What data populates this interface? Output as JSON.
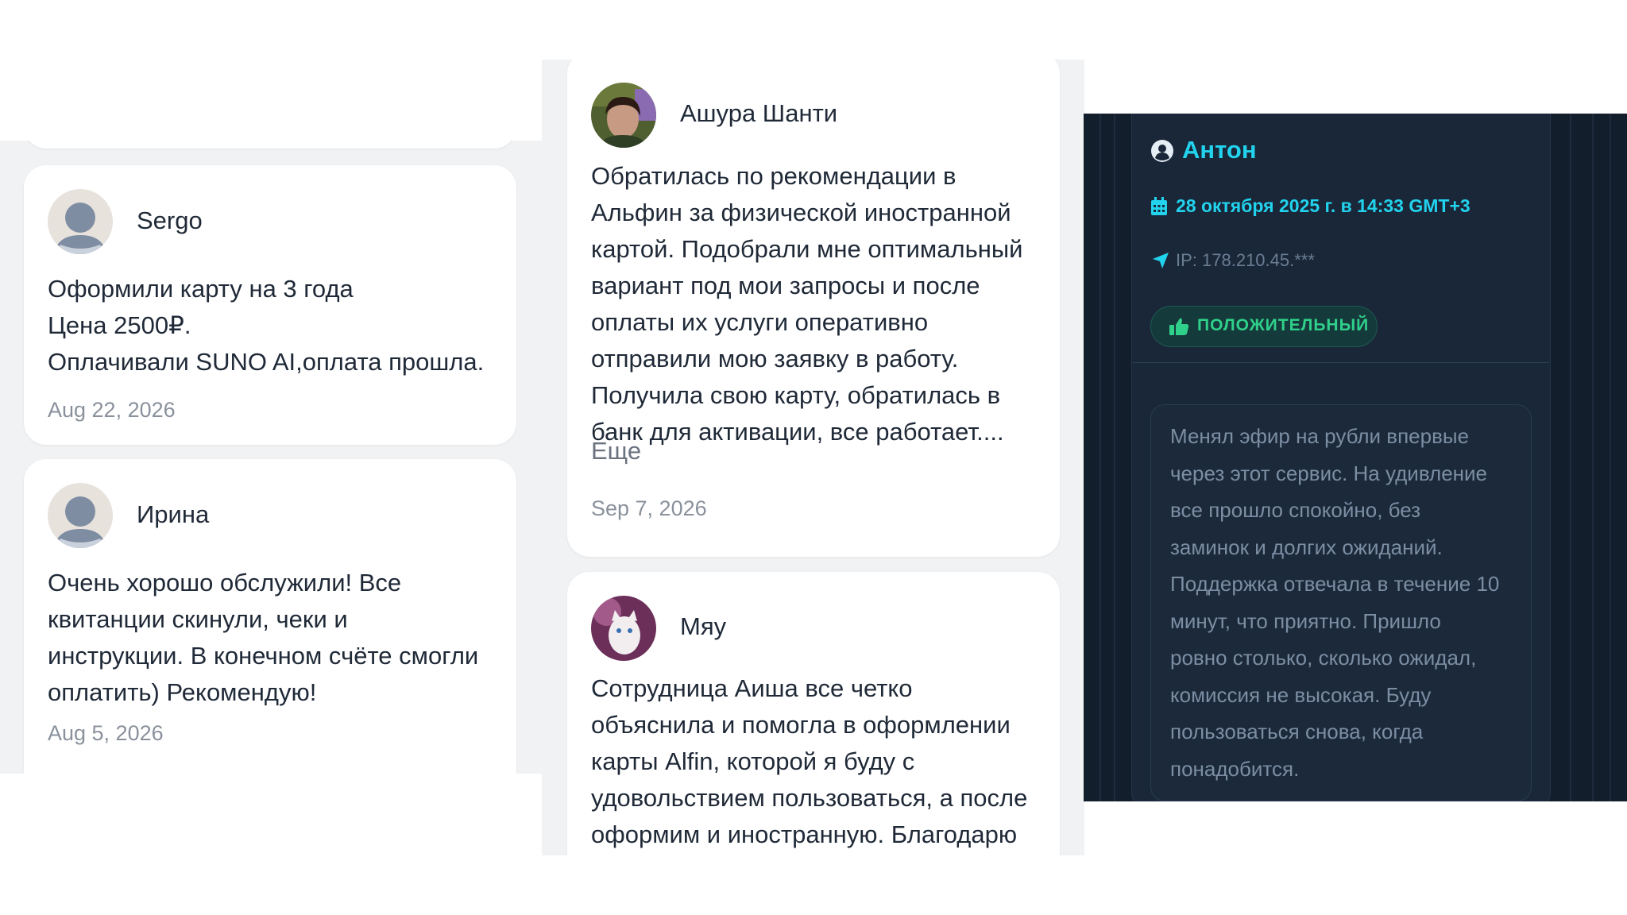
{
  "left_panel": {
    "reviews": [
      {
        "author": "Sergo",
        "text": "Оформили карту на 3 года\nЦена 2500₽.\nОплачивали SUNO AI,оплата прошла.",
        "date": "Aug 22, 2026"
      },
      {
        "author": "Ирина",
        "text": "Очень хорошо обслужили! Все\nквитанции скинули, чеки и\nинструкции. В конечном счёте смогли\nоплатить) Рекомендую!",
        "date": "Aug 5, 2026"
      }
    ]
  },
  "middle_panel": {
    "reviews": [
      {
        "author": "Ашура Шанти",
        "text": "Обратилась по рекомендации в\nАльфин за физической иностранной\nкартой. Подобрали мне оптимальный\nвариант под мои запросы и после\nоплаты их услуги оперативно\nотправили мою заявку в работу.\nПолучила свою карту, обратилась в\nбанк для активации, все работает....",
        "more": "Еще",
        "date": "Sep 7, 2026"
      },
      {
        "author": "Мяу",
        "text": "Сотрудница Аиша все четко\nобъяснила и помогла в оформлении\nкарты Alfin, которой я буду с\nудовольствием пользоваться, а после\nоформим и иностранную. Благодарю"
      }
    ]
  },
  "right_panel": {
    "author": "Антон",
    "datetime": "28 октября 2025 г. в 14:33 GMT+3",
    "ip": "IP: 178.210.45.***",
    "badge": "ПОЛОЖИТЕЛЬНЫЙ",
    "text": "Менял эфир на рубли впервые\nчерез этот сервис. На удивление\nвсе прошло спокойно, без\nзаминок и долгих ожиданий.\nПоддержка отвечала в течение 10\nминут, что приятно. Пришло\nровно столько, сколько ожидал,\nкомиссия не высокая. Буду\nпользоваться снова, когда\nпонадобится."
  },
  "colors": {
    "light_bg": "#f1f2f4",
    "card_bg": "#ffffff",
    "dark_bg": "#131e2c",
    "accent_cyan": "#22d3ee",
    "positive_green": "#2fd08a"
  },
  "icons": [
    "default-user-avatar",
    "user-photo-avatar",
    "cat-photo-avatar",
    "user-circle-icon",
    "calendar-icon",
    "location-arrow-icon",
    "thumbs-up-icon"
  ]
}
